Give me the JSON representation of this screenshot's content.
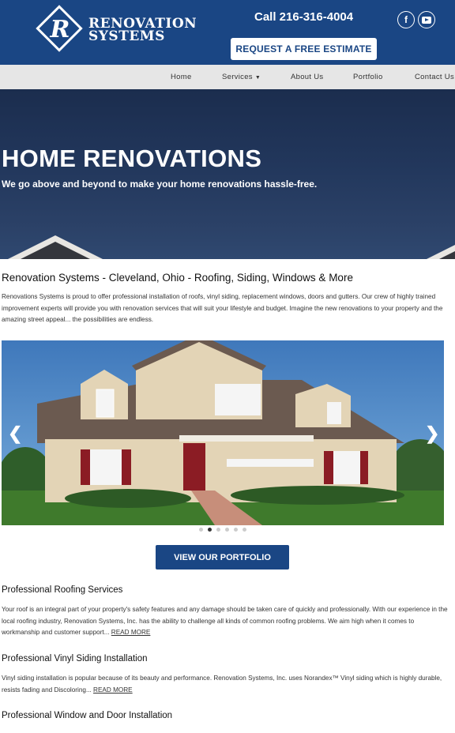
{
  "header": {
    "logo_line1": "RENOVATION",
    "logo_line2": "SYSTEMS",
    "logo_mark": "R",
    "phone": "Call 216-316-4004",
    "estimate_label": "REQUEST A FREE ESTIMATE",
    "facebook_glyph": "f",
    "social_icons": [
      "facebook-icon",
      "youtube-icon"
    ]
  },
  "nav": {
    "items": [
      {
        "label": "Home"
      },
      {
        "label": "Services",
        "has_dropdown": true
      },
      {
        "label": "About Us"
      },
      {
        "label": "Portfolio"
      },
      {
        "label": "Contact Us"
      }
    ]
  },
  "hero": {
    "title": "HOME RENOVATIONS",
    "subtitle": "We go above and beyond to make your home renovations hassle-free."
  },
  "intro": {
    "title": "Renovation Systems - Cleveland, Ohio - Roofing, Siding, Windows & More",
    "text": "Renovations Systems is proud to offer professional installation of roofs, vinyl siding, replacement windows, doors and gutters. Our crew of highly trained improvement experts will provide you with renovation services that will suit your lifestyle and budget. Imagine the new renovations to your property and the amazing street appeal... the possibilities are endless."
  },
  "carousel": {
    "prev_glyph": "❮",
    "next_glyph": "❯",
    "dot_count": 6,
    "active_dot": 2
  },
  "portfolio_button": "VIEW OUR PORTFOLIO",
  "sections": [
    {
      "title": "Professional Roofing Services",
      "text": "Your roof is an integral part of your property's safety features and any damage should be taken care of quickly and professionally. With our experience in the local roofing industry, Renovation Systems, Inc. has the ability to challenge all kinds of common roofing problems. We aim high when it comes to workmanship and customer support... ",
      "link": "READ MORE"
    },
    {
      "title": "Professional Vinyl Siding Installation",
      "text": "Vinyl siding installation is popular because of its beauty and performance. Renovation Systems, Inc. uses Norandex™ Vinyl siding which is highly durable, resists fading and Discoloring... ",
      "link": "READ MORE"
    },
    {
      "title": "Professional Window and Door Installation"
    }
  ],
  "colors": {
    "brand": "#1a4684",
    "nav_bg": "#e6e6e6"
  }
}
